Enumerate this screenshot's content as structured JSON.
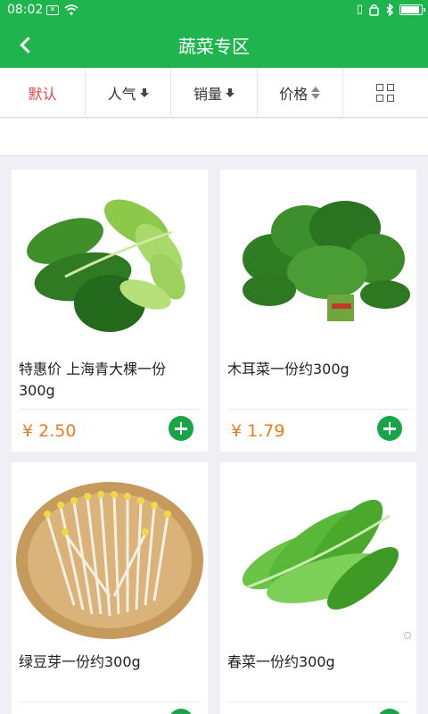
{
  "status_bar": {
    "time": "08:02",
    "notification_icon": "mail-x-icon",
    "wifi_icon": "wifi-icon",
    "right_icons": [
      "vibrate-icon",
      "alarm-icon",
      "bluetooth-icon",
      "battery-icon"
    ],
    "battery_level": 0.9
  },
  "header": {
    "title": "蔬菜专区",
    "back_icon": "back-arrow-icon",
    "background_color": "#1fb44e"
  },
  "sort_tabs": [
    {
      "label": "默认",
      "active": true
    },
    {
      "label": "人气",
      "icon": "down-arrow-icon"
    },
    {
      "label": "销量",
      "icon": "down-arrow-icon"
    },
    {
      "label": "价格",
      "icon": "sort-updown-icon"
    },
    {
      "label": "",
      "icon": "grid-view-icon"
    }
  ],
  "colors": {
    "accent": "#1fb44e",
    "active_tab": "#e64545",
    "price": "#f07a1f",
    "add_button": "#19a447"
  },
  "products": [
    {
      "name": "特惠价 上海青大棵一份300g",
      "price": "¥ 2.50",
      "image": "bok-choy"
    },
    {
      "name": "木耳菜一份约300g",
      "price": "¥ 1.79",
      "image": "malabar-spinach"
    },
    {
      "name": "绿豆芽一份约300g",
      "price": "",
      "image": "mung-bean-sprouts"
    },
    {
      "name": "春菜一份约300g",
      "price": "",
      "image": "leafy-greens"
    }
  ]
}
